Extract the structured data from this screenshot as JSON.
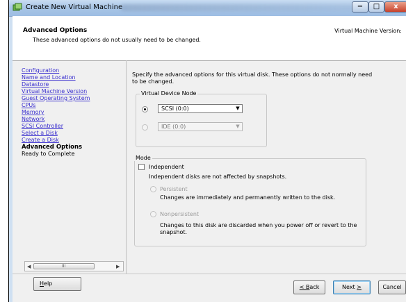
{
  "window": {
    "title": "Create New Virtual Machine",
    "buttons": {
      "minimize": "−",
      "maximize": "□",
      "close": "x"
    }
  },
  "header": {
    "title": "Advanced Options",
    "subtitle": "These advanced options do not usually need to be changed.",
    "version_label": "Virtual Machine Version:"
  },
  "nav": {
    "items": [
      {
        "label": "Configuration",
        "state": "link"
      },
      {
        "label": "Name and Location",
        "state": "link"
      },
      {
        "label": "Datastore",
        "state": "link"
      },
      {
        "label": "Virtual Machine Version",
        "state": "link"
      },
      {
        "label": "Guest Operating System",
        "state": "link"
      },
      {
        "label": "CPUs",
        "state": "link"
      },
      {
        "label": "Memory",
        "state": "link"
      },
      {
        "label": "Network",
        "state": "link"
      },
      {
        "label": "SCSI Controller",
        "state": "link"
      },
      {
        "label": "Select a Disk",
        "state": "link"
      },
      {
        "label": "Create a Disk",
        "state": "link"
      },
      {
        "label": "Advanced Options",
        "state": "current"
      },
      {
        "label": "Ready to Complete",
        "state": "plain"
      }
    ],
    "scrollbar_grip": "III"
  },
  "content": {
    "intro": "Specify the advanced options for this virtual disk. These options do not normally need to be changed.",
    "virtual_device_node": {
      "legend": "Virtual Device Node",
      "scsi": {
        "value": "SCSI (0:0)",
        "selected": true
      },
      "ide": {
        "value": "IDE (0:0)",
        "selected": false
      }
    },
    "mode": {
      "legend": "Mode",
      "independent_label": "Independent",
      "independent_checked": false,
      "independent_desc": "Independent disks are not affected by snapshots.",
      "persistent_label": "Persistent",
      "persistent_desc": "Changes are immediately and permanently written to the disk.",
      "nonpersistent_label": "Nonpersistent",
      "nonpersistent_desc": "Changes to this disk are discarded when you power off or revert to the snapshot."
    }
  },
  "footer": {
    "help": {
      "first": "H",
      "rest": "elp"
    },
    "back": {
      "prefix": "",
      "under": "< B",
      "rest": "ack"
    },
    "next": {
      "prefix": "Next ",
      "under": ">",
      "rest": ""
    },
    "cancel": "Cancel"
  },
  "colors": {
    "link": "#3a2fcf",
    "window_frame": "#cfe0f2",
    "dialog_bg": "#f0f0f0",
    "close_button": "#c8412b"
  }
}
